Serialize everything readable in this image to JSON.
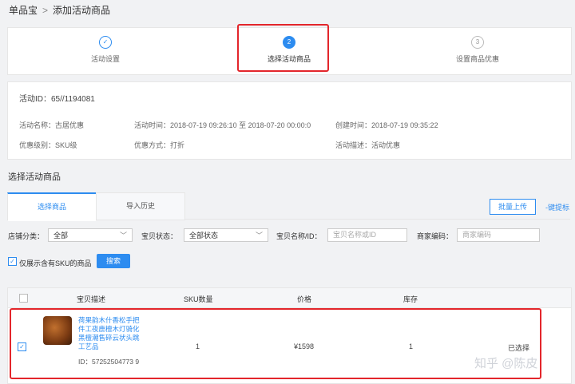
{
  "breadcrumb": {
    "root": "单品宝",
    "separator": ">",
    "current": "添加活动商品"
  },
  "steps": [
    {
      "label": "活动设置",
      "icon": "✓"
    },
    {
      "label": "选择活动商品",
      "icon": "2"
    },
    {
      "label": "设置商品优惠",
      "icon": "3"
    }
  ],
  "info": {
    "activity_id": "活动ID：65//1194081",
    "name": "活动名称：古居优惠",
    "time": "活动时间：2018-07-19 09:26:10 至 2018-07-20 00:00:0",
    "created": "创建时间：2018-07-19 09:35:22",
    "level": "优惠级别：SKU级",
    "method": "优惠方式：打折",
    "desc": "活动描述：活动优惠"
  },
  "section_title": "选择活动商品",
  "tabs": {
    "tab1": "选择商品",
    "tab2": "导入历史"
  },
  "actions": {
    "bulk_button": "批量上传",
    "bulk_link": "-键提标"
  },
  "filters": {
    "category_label": "店铺分类：",
    "category_value": "全部",
    "status_label": "宝贝状态：",
    "status_value": "全部状态",
    "name_label": "宝贝名称/ID：",
    "name_placeholder": "宝贝名称或ID",
    "code_label": "商家编码：",
    "code_placeholder": "商家编码",
    "only_sku_label": "仅展示含有SKU的商品",
    "search_button": "搜索"
  },
  "table": {
    "headers": {
      "desc": "宝贝描述",
      "sku": "SKU数量",
      "price": "价格",
      "stock": "库存"
    },
    "rows": [
      {
        "title": "荷果韵木什香松手把件工夜鹿檀木灯骑化黑檀潮售碎云状头跳工艺品",
        "id": "ID：57252504773 9",
        "sku": "1",
        "price": "¥1598",
        "stock": "1",
        "status": "已选择"
      }
    ]
  },
  "watermark": "知乎 @陈皮",
  "colors": {
    "accent": "#2d8cf0",
    "highlight": "#e3262b"
  }
}
